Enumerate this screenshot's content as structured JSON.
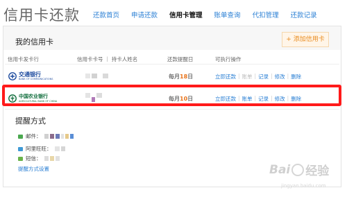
{
  "header": {
    "title": "信用卡还款",
    "nav": [
      {
        "label": "还款首页",
        "active": false
      },
      {
        "label": "申请还款",
        "active": false
      },
      {
        "label": "信用卡管理",
        "active": true
      },
      {
        "label": "账单查询",
        "active": false
      },
      {
        "label": "代扣管理",
        "active": false
      },
      {
        "label": "还款记录",
        "active": false
      }
    ]
  },
  "cards_panel": {
    "title": "我的信用卡",
    "add_button": "+ 添加信用卡",
    "columns": {
      "issuer": "信用卡发卡行",
      "card_holder": "信用卡卡号 ｜ 持卡人姓名",
      "reminder_day": "还款提醒日",
      "actions": "可执行操作"
    },
    "rows": [
      {
        "bank_name": "交通银行",
        "bank_name_en": "BANK OF COMMUNICATIONS",
        "remind_prefix": "每月",
        "remind_day": "18",
        "remind_suffix": "日",
        "selected": true,
        "actions": [
          {
            "label": "立即还款",
            "enabled": true
          },
          {
            "label": "账单",
            "enabled": false
          },
          {
            "label": "记录",
            "enabled": true
          },
          {
            "label": "修改",
            "enabled": true
          },
          {
            "label": "删除",
            "enabled": true
          }
        ]
      },
      {
        "bank_name": "中国农业银行",
        "bank_name_en": "AGRICULTURAL BANK OF CHINA",
        "remind_prefix": "每月",
        "remind_day": "10",
        "remind_suffix": "日",
        "selected": false,
        "actions": [
          {
            "label": "立即还款",
            "enabled": true
          },
          {
            "label": "账单",
            "enabled": true
          },
          {
            "label": "记录",
            "enabled": true
          },
          {
            "label": "修改",
            "enabled": true
          },
          {
            "label": "删除",
            "enabled": true
          }
        ]
      }
    ]
  },
  "reminder_section": {
    "title": "提醒方式",
    "methods": [
      {
        "label": "邮件：",
        "icon": "mail-icon"
      },
      {
        "label": "阿里旺旺：",
        "icon": "wangwang-icon"
      },
      {
        "label": "短信：",
        "icon": "sms-icon"
      }
    ],
    "settings_link": "提醒方式设置"
  },
  "watermark": {
    "brand": "Bai",
    "product": "经验",
    "url": "jingyan.baidu.com"
  },
  "colors": {
    "link": "#2a7fd4",
    "accent_orange": "#e8731b",
    "highlight_border": "#ff1a1a"
  }
}
